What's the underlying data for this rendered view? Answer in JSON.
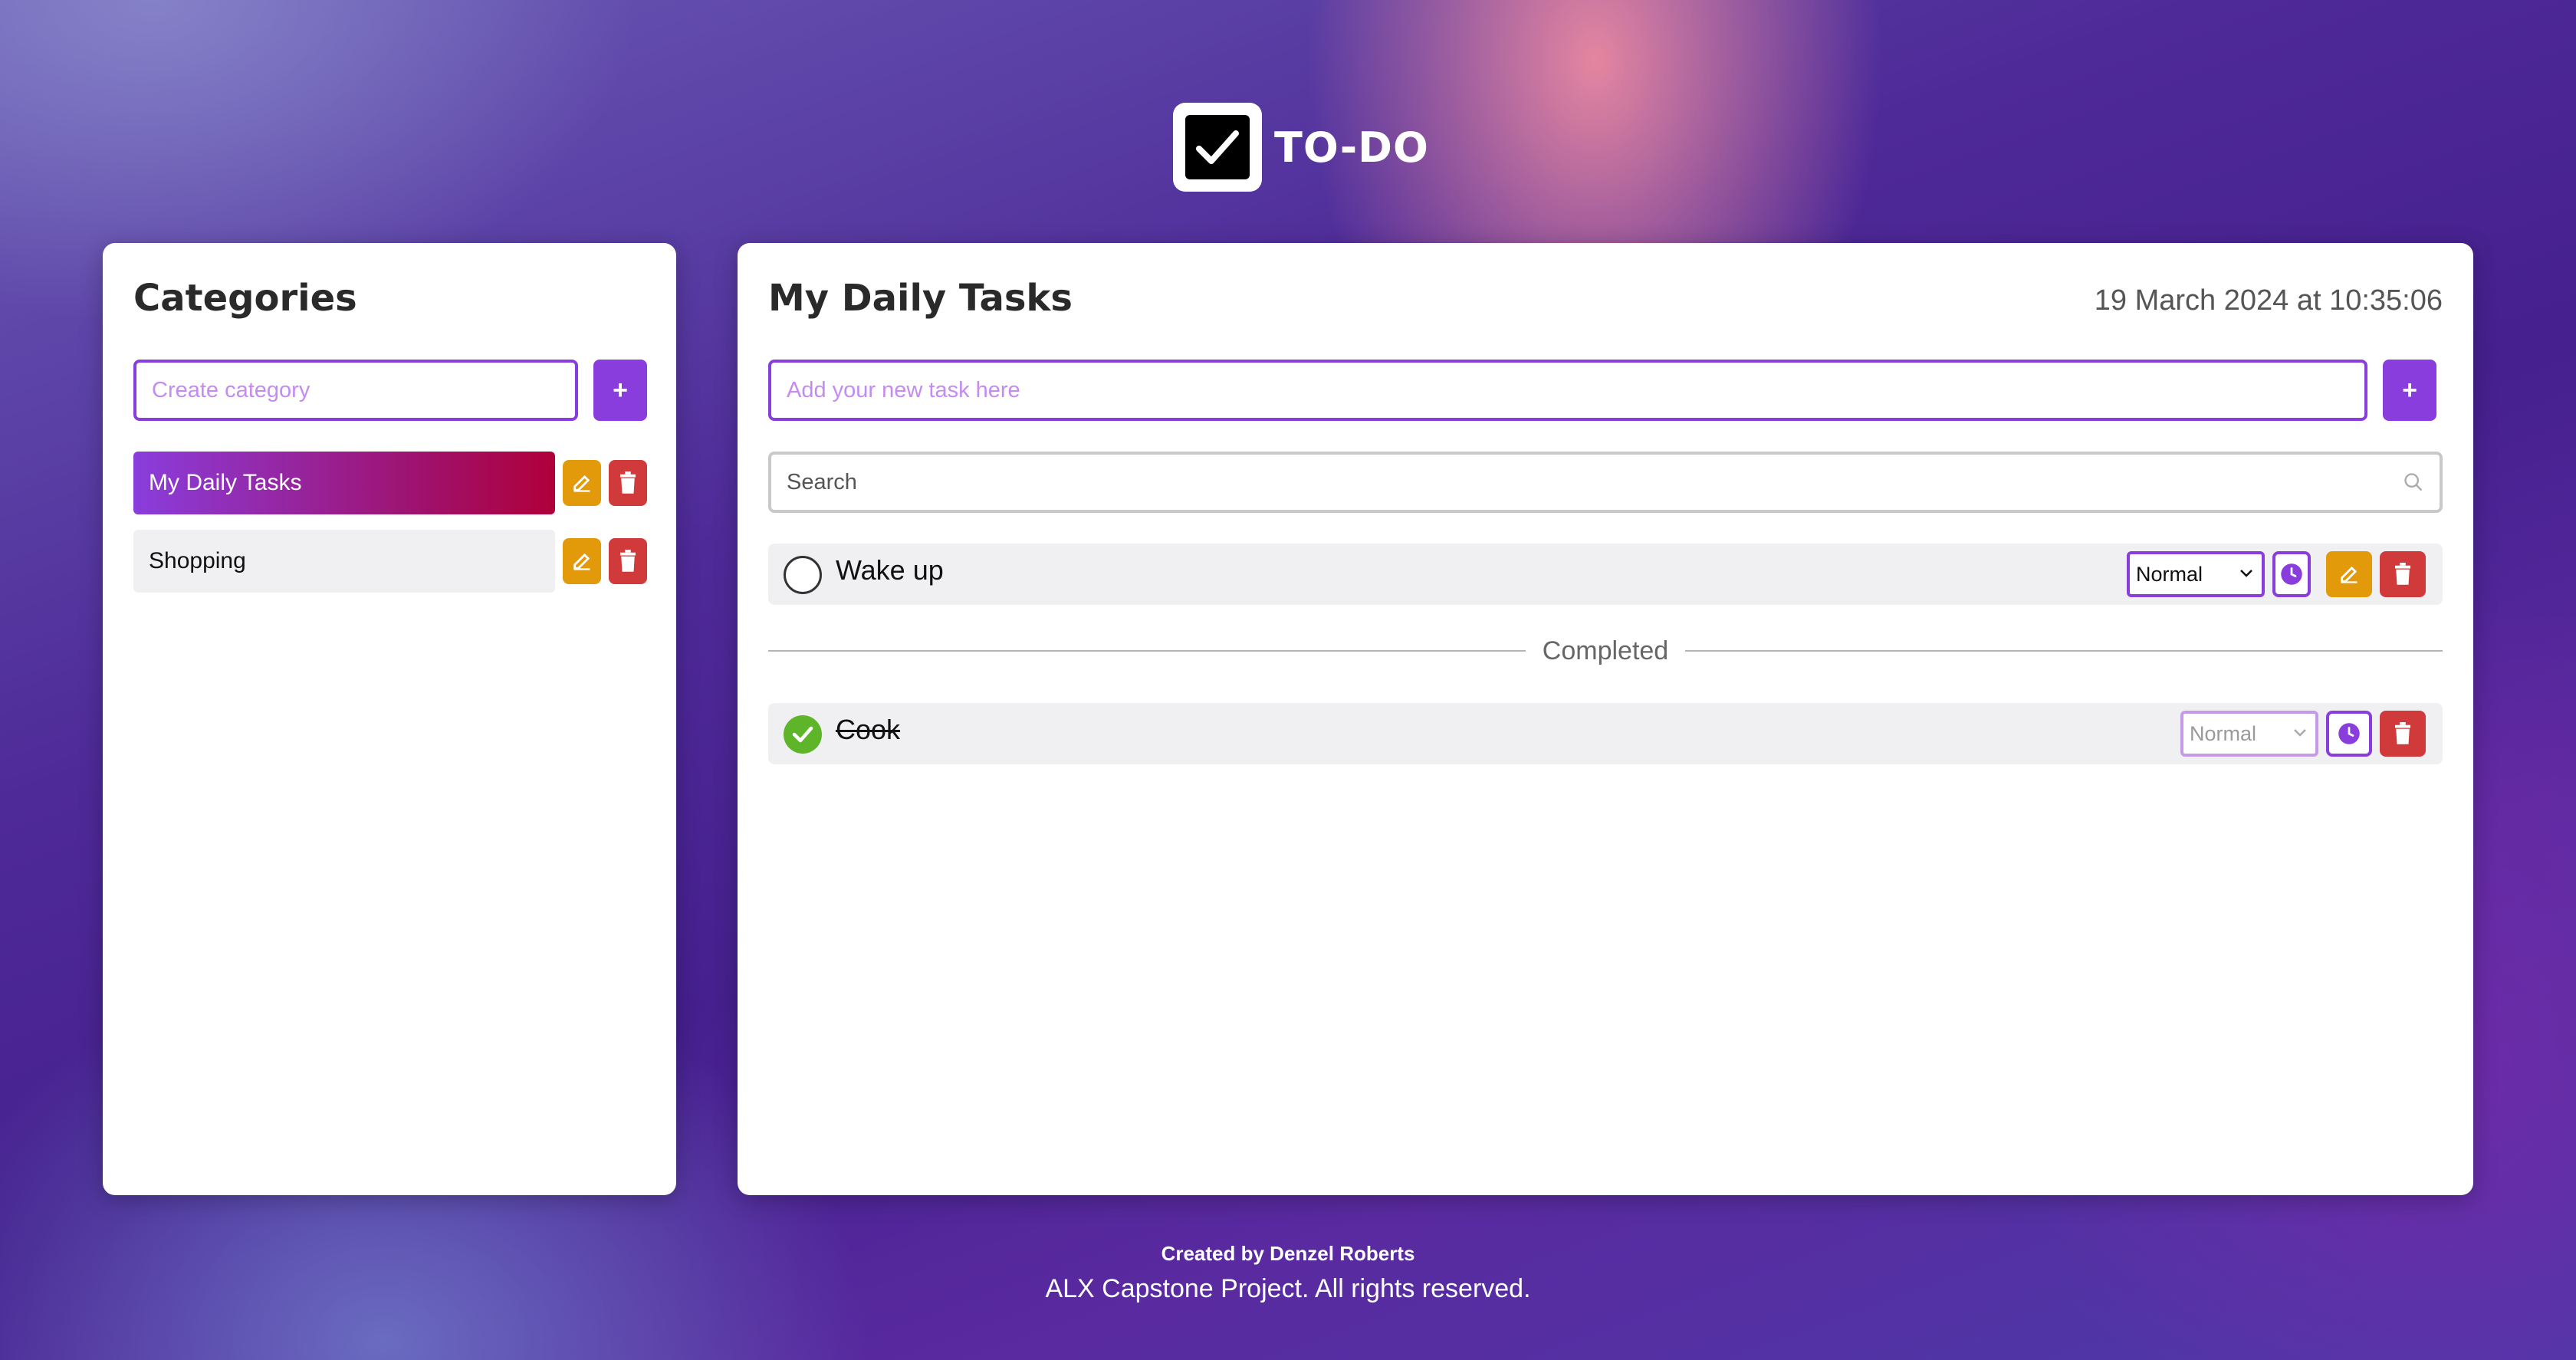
{
  "app": {
    "logo_text": "TO-DO",
    "logo_icon": "checkbox-icon"
  },
  "categories": {
    "title": "Categories",
    "input_placeholder": "Create category",
    "add_label": "+",
    "items": [
      {
        "label": "My Daily Tasks",
        "active": true
      },
      {
        "label": "Shopping",
        "active": false
      }
    ]
  },
  "main": {
    "title": "My Daily Tasks",
    "datetime": "19 March 2024 at 10:35:06",
    "task_placeholder": "Add your new task here",
    "add_label": "+",
    "search_placeholder": "Search",
    "tasks": [
      {
        "label": "Wake up",
        "priority": "Normal",
        "completed": false
      }
    ],
    "completed_label": "Completed",
    "completed_tasks": [
      {
        "label": "Cook",
        "priority": "Normal",
        "completed": true
      }
    ]
  },
  "footer": {
    "credit": "Created by Denzel Roberts",
    "rights": "ALX Capstone Project. All rights reserved."
  },
  "colors": {
    "accent": "#8a3ddd",
    "edit": "#e29a0a",
    "delete": "#d13a3a",
    "done": "#5fb52a"
  }
}
